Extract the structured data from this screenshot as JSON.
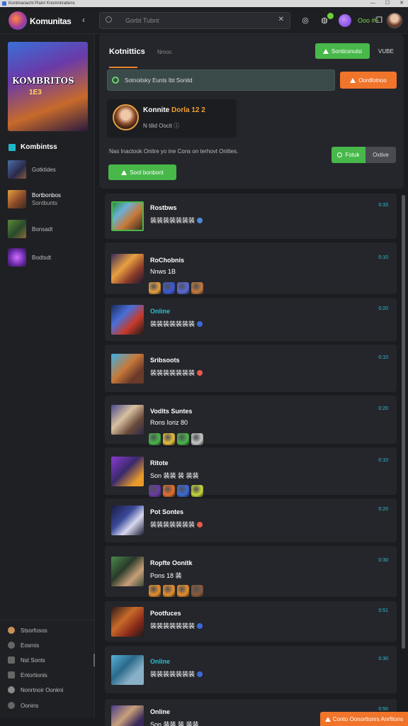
{
  "window": {
    "title": "Kontmanacht Plaint Knomntiratiens"
  },
  "topbar": {
    "brand": "Komunitas",
    "collapse_glyph": "‹",
    "search_placeholder": "Gorbt Tubnt",
    "status_text": "Ooo #6"
  },
  "sidebar": {
    "art_title": "KOMBRITOS",
    "art_subtitle": "1E3",
    "section_label": "Kombintss",
    "items": [
      {
        "label": "Gotktides"
      },
      {
        "label": "Bortbonbos",
        "sublabel": "Sontbunts"
      },
      {
        "label": "Bonsadt"
      },
      {
        "label": "Bodtsdt"
      }
    ],
    "bottom": [
      {
        "label": "Stsorfosos",
        "icon": "sun-icon"
      },
      {
        "label": "Eosmis",
        "icon": "gear-icon"
      },
      {
        "label": "Nst Sonts",
        "icon": "chat-icon"
      },
      {
        "label": "Entortionis",
        "icon": "list-icon"
      },
      {
        "label": "Nonrtnoir Oonkni",
        "icon": "user-icon"
      },
      {
        "label": "Oonins",
        "icon": "help-icon"
      }
    ]
  },
  "main": {
    "title": "Kotnittics",
    "subtitle": "Nmoc",
    "join_button": "Sonticsnutsi",
    "vibe_label": "VUBE",
    "info_text": "Sotnoitsky  Eunts  Ibt  Sonitd",
    "orange_button": "Oontfotnoo",
    "profile": {
      "name": "Konnite",
      "name_highlight": "Dorla 12 2",
      "meta": "N tilid Oocit"
    },
    "description": "Nas Inactook Onitre yo ine Cons on terhovt Onlites.",
    "seg_on": "Fotuk",
    "seg_off": "Oxtive",
    "create_button": "Soot bonbont"
  },
  "posts": [
    {
      "title": "Rostbws",
      "sub": "装装装装装装装",
      "time": "0:33",
      "teal": false
    },
    {
      "title": "RoChobnis",
      "sub": "Nnws 1B",
      "time": "0:10",
      "teal": false
    },
    {
      "title": "Online",
      "sub": "装装装装装装装",
      "time": "0:20",
      "teal": true
    },
    {
      "title": "Sribsoots",
      "sub": "装装装装装装装",
      "time": "0:10",
      "teal": false
    },
    {
      "title": "Vodlts Suntes",
      "sub": "Rons Ioriz 80",
      "time": "0:20",
      "teal": false
    },
    {
      "title": "Ritote",
      "sub": "Son 装装 装 装装",
      "time": "0:10",
      "teal": false
    },
    {
      "title": "Pot Sontes",
      "sub": "装装装装装装装",
      "time": "0:20",
      "teal": false
    },
    {
      "title": "Ropfte Oonitk",
      "sub": "Pons 18 装",
      "time": "0:30",
      "teal": false
    },
    {
      "title": "Pootfuces",
      "sub": "装装装装装装装",
      "time": "0:51",
      "teal": false
    },
    {
      "title": "Online",
      "sub": "装装装装装装装",
      "time": "0:30",
      "teal": true
    },
    {
      "title": "Online",
      "sub": "Son 装装 装 装装",
      "time": "0:50",
      "teal": false
    }
  ],
  "toast": {
    "label": "Conto Oonorttonrs Anrfitons"
  }
}
